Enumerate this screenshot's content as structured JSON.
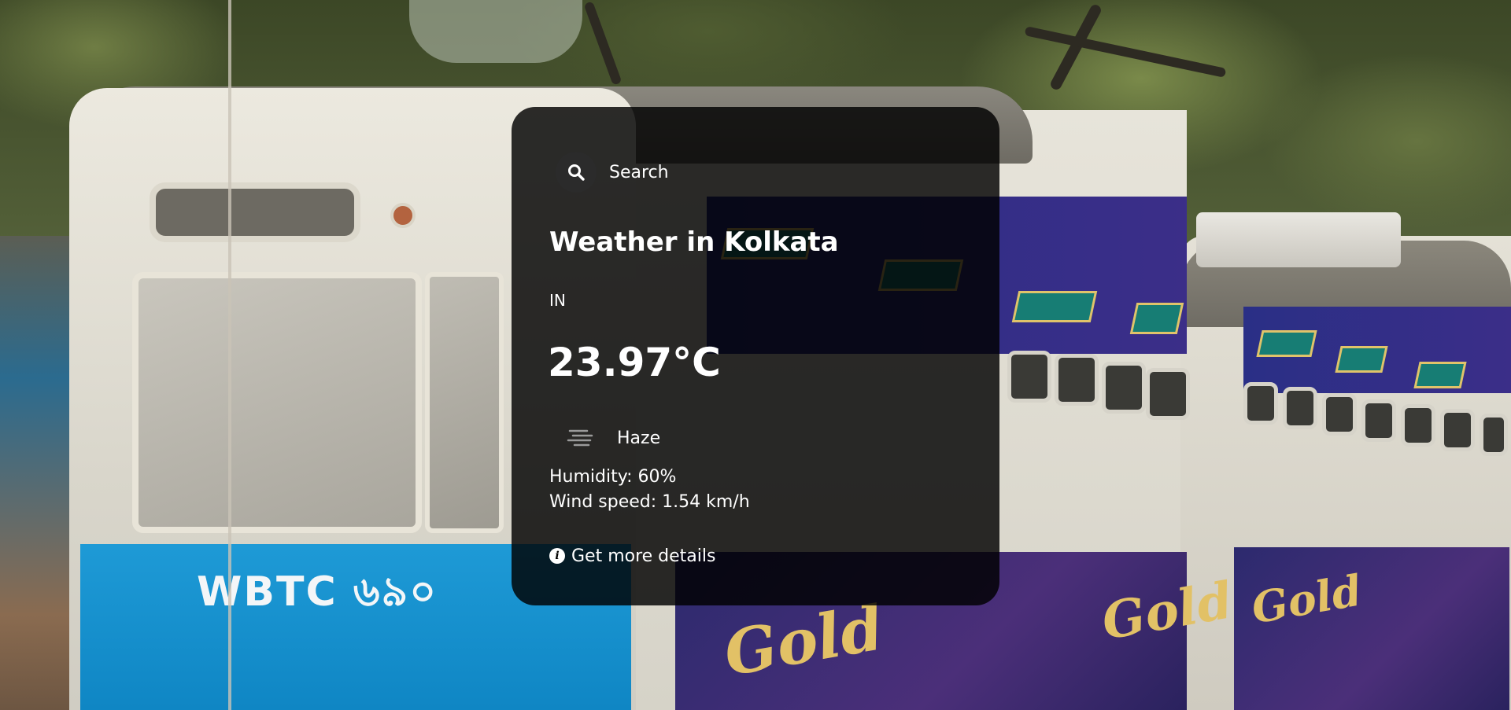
{
  "search": {
    "label": "Search",
    "icon": "search-icon"
  },
  "weather": {
    "title": "Weather in Kolkata",
    "country": "IN",
    "temperature": "23.97°C",
    "condition": "Haze",
    "condition_icon": "haze-icon",
    "humidity": "Humidity: 60%",
    "wind": "Wind speed: 1.54 km/h"
  },
  "details": {
    "label": "Get more details",
    "icon": "info-icon"
  },
  "background": {
    "plate_text": "WBTC ৬৯০",
    "ad_text": "Gold"
  },
  "colors": {
    "card_background": "rgba(0,0,0,0.82)",
    "text": "#ffffff",
    "tram_blue": "#1e9ad6"
  }
}
